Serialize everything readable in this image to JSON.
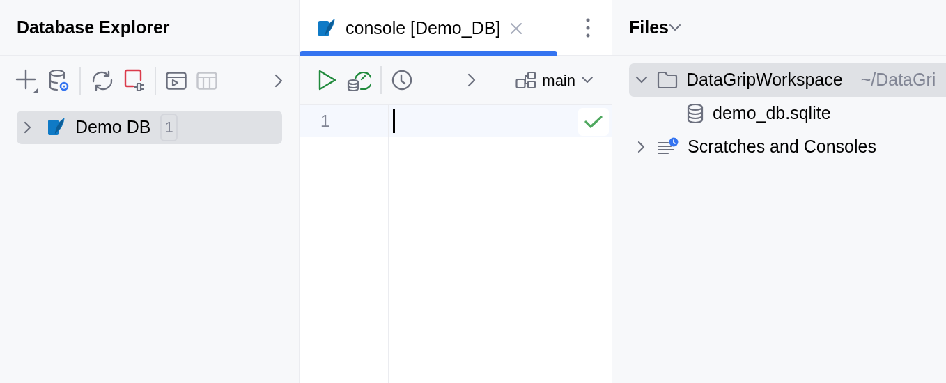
{
  "explorer": {
    "title": "Database Explorer",
    "toolbar": [
      {
        "kind": "add",
        "disabled": false
      },
      {
        "kind": "db-settings",
        "disabled": false
      },
      {
        "kind": "separator"
      },
      {
        "kind": "refresh",
        "disabled": false
      },
      {
        "kind": "disconnect",
        "disabled": false
      },
      {
        "kind": "separator"
      },
      {
        "kind": "console",
        "disabled": false
      },
      {
        "kind": "table",
        "disabled": true
      },
      {
        "kind": "more",
        "disabled": false
      }
    ],
    "tree": [
      {
        "label": "Demo DB",
        "badge": "1",
        "kind": "sqlite",
        "expanded": false,
        "selected": true
      }
    ]
  },
  "editor": {
    "tabs": [
      {
        "label": "console [Demo_DB]",
        "selected": true
      }
    ],
    "toolbar": [
      {
        "kind": "run"
      },
      {
        "kind": "explain"
      },
      {
        "kind": "separator"
      },
      {
        "kind": "history"
      },
      {
        "kind": "more"
      }
    ],
    "schema": "main",
    "lines": [
      "1"
    ]
  },
  "files": {
    "title": "Files",
    "tree": [
      {
        "label": "DataGripWorkspace",
        "path": "~/DataGri",
        "kind": "folder",
        "expanded": true,
        "selected": true,
        "children": [
          {
            "label": "demo_db.sqlite",
            "kind": "database",
            "selected": false
          }
        ]
      },
      {
        "label": "Scratches and Consoles",
        "kind": "scratches",
        "expanded": false,
        "selected": false
      }
    ]
  }
}
